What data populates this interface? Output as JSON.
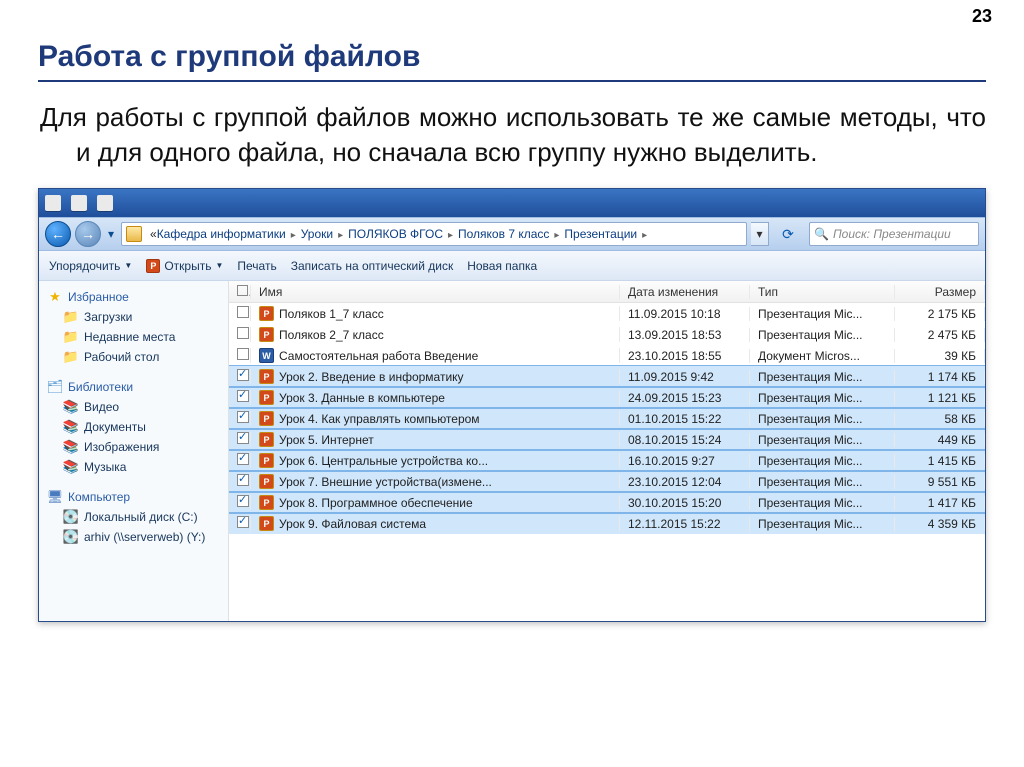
{
  "page_number": "23",
  "slide_title": "Работа с группой файлов",
  "slide_body": "Для работы с группой файлов можно использовать те же самые методы, что и для одного файла, но сначала всю группу нужно выделить.",
  "breadcrumb": {
    "segments": [
      "Кафедра информатики",
      "Уроки",
      "ПОЛЯКОВ ФГОС",
      "Поляков 7 класс",
      "Презентации"
    ]
  },
  "search_placeholder": "Поиск: Презентации",
  "toolbar": {
    "organize": "Упорядочить",
    "open": "Открыть",
    "print": "Печать",
    "burn": "Записать на оптический диск",
    "new_folder": "Новая папка"
  },
  "sidebar": {
    "favorites_label": "Избранное",
    "favorites": [
      {
        "label": "Загрузки",
        "icon": "folder"
      },
      {
        "label": "Недавние места",
        "icon": "folder"
      },
      {
        "label": "Рабочий стол",
        "icon": "folder"
      }
    ],
    "libraries_label": "Библиотеки",
    "libraries": [
      {
        "label": "Видео",
        "icon": "lib"
      },
      {
        "label": "Документы",
        "icon": "lib"
      },
      {
        "label": "Изображения",
        "icon": "lib"
      },
      {
        "label": "Музыка",
        "icon": "lib"
      }
    ],
    "computer_label": "Компьютер",
    "computer": [
      {
        "label": "Локальный диск (C:)",
        "icon": "disk"
      },
      {
        "label": "arhiv (\\\\serverweb) (Y:)",
        "icon": "disk"
      }
    ]
  },
  "columns": {
    "name": "Имя",
    "date": "Дата изменения",
    "type": "Тип",
    "size": "Размер"
  },
  "files": [
    {
      "selected": false,
      "icon": "ppt",
      "name": "Поляков 1_7 класс",
      "date": "11.09.2015 10:18",
      "type": "Презентация Mic...",
      "size": "2 175 КБ"
    },
    {
      "selected": false,
      "icon": "ppt",
      "name": "Поляков 2_7 класс",
      "date": "13.09.2015 18:53",
      "type": "Презентация Mic...",
      "size": "2 475 КБ"
    },
    {
      "selected": false,
      "icon": "doc",
      "name": "Самостоятельная работа Введение",
      "date": "23.10.2015 18:55",
      "type": "Документ Micros...",
      "size": "39 КБ"
    },
    {
      "selected": true,
      "icon": "ppt",
      "name": "Урок 2. Введение в информатику",
      "date": "11.09.2015 9:42",
      "type": "Презентация Mic...",
      "size": "1 174 КБ"
    },
    {
      "selected": true,
      "icon": "ppt",
      "name": "Урок 3. Данные в компьютере",
      "date": "24.09.2015 15:23",
      "type": "Презентация Mic...",
      "size": "1 121 КБ"
    },
    {
      "selected": true,
      "icon": "ppt",
      "name": "Урок 4. Как управлять компьютером",
      "date": "01.10.2015 15:22",
      "type": "Презентация Mic...",
      "size": "58 КБ"
    },
    {
      "selected": true,
      "icon": "ppt",
      "name": "Урок 5. Интернет",
      "date": "08.10.2015 15:24",
      "type": "Презентация Mic...",
      "size": "449 КБ"
    },
    {
      "selected": true,
      "icon": "ppt",
      "name": "Урок 6. Центральные устройства ко...",
      "date": "16.10.2015 9:27",
      "type": "Презентация Mic...",
      "size": "1 415 КБ"
    },
    {
      "selected": true,
      "icon": "ppt",
      "name": "Урок 7. Внешние устройства(измене...",
      "date": "23.10.2015 12:04",
      "type": "Презентация Mic...",
      "size": "9 551 КБ"
    },
    {
      "selected": true,
      "icon": "ppt",
      "name": "Урок 8. Программное обеспечение",
      "date": "30.10.2015 15:20",
      "type": "Презентация Mic...",
      "size": "1 417 КБ"
    },
    {
      "selected": true,
      "icon": "ppt",
      "name": "Урок 9. Файловая система",
      "date": "12.11.2015 15:22",
      "type": "Презентация Mic...",
      "size": "4 359 КБ"
    }
  ]
}
